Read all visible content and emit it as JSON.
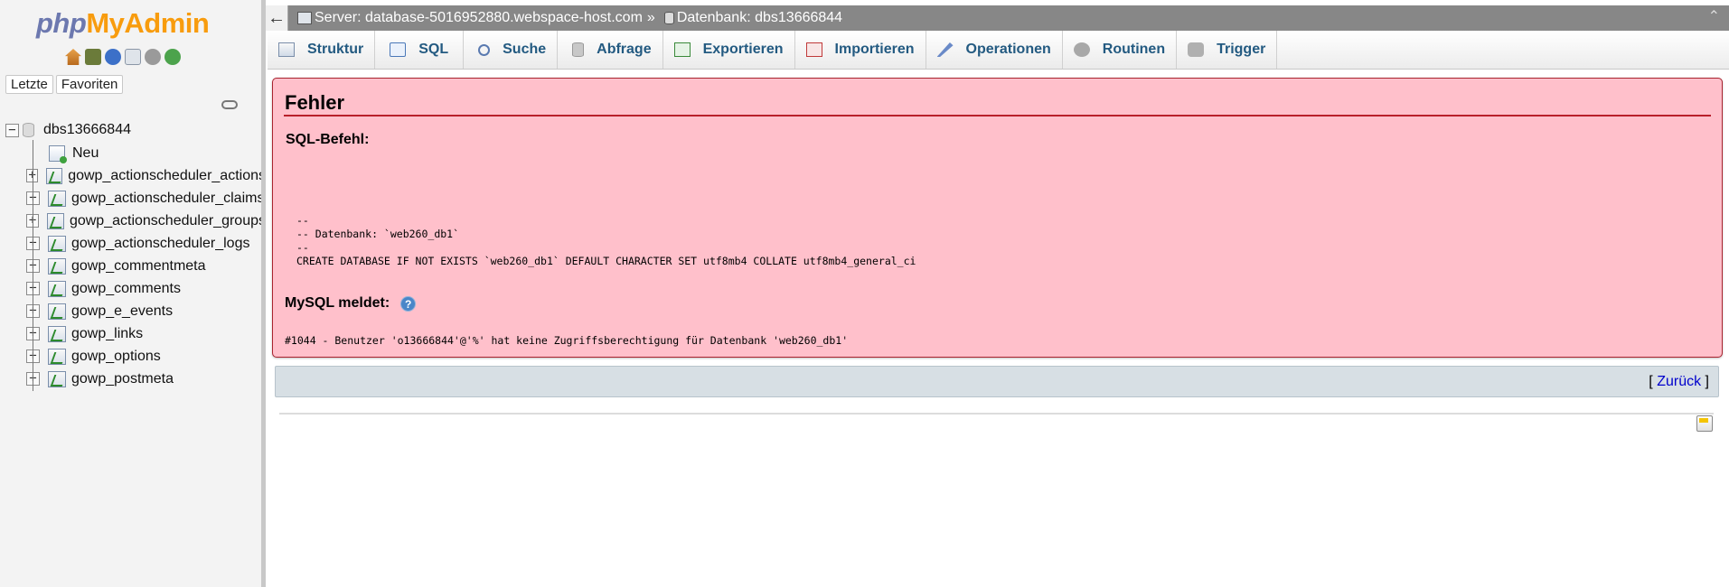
{
  "nav": {
    "logo": {
      "php": "php",
      "my": "My",
      "admin": "Admin"
    },
    "icons": [
      "home-icon",
      "exit-icon",
      "help-icon",
      "docs-icon",
      "settings-icon",
      "reload-icon"
    ],
    "tabs": {
      "recent": "Letzte",
      "favorites": "Favoriten"
    },
    "database": "dbs13666844",
    "new_label": "Neu",
    "expand_symbol": "+",
    "collapse_symbol": "−",
    "tables": [
      "gowp_actionscheduler_actions",
      "gowp_actionscheduler_claims",
      "gowp_actionscheduler_groups",
      "gowp_actionscheduler_logs",
      "gowp_commentmeta",
      "gowp_comments",
      "gowp_e_events",
      "gowp_links",
      "gowp_options",
      "gowp_postmeta"
    ]
  },
  "topbar": {
    "back_symbol": "←",
    "server": "Server: database-5016952880.webspace-host.com",
    "separator": "»",
    "database": "Datenbank: dbs13666844",
    "collapse_symbol": "⌃"
  },
  "tabs": [
    {
      "label": "Struktur",
      "icon": "structure-icon"
    },
    {
      "label": "SQL",
      "icon": "sql-icon"
    },
    {
      "label": "Suche",
      "icon": "search-icon"
    },
    {
      "label": "Abfrage",
      "icon": "query-icon"
    },
    {
      "label": "Exportieren",
      "icon": "export-icon"
    },
    {
      "label": "Importieren",
      "icon": "import-icon"
    },
    {
      "label": "Operationen",
      "icon": "wrench-icon"
    },
    {
      "label": "Routinen",
      "icon": "routines-icon"
    },
    {
      "label": "Trigger",
      "icon": "trigger-icon"
    }
  ],
  "error": {
    "title": "Fehler",
    "sql_label": "SQL-Befehl:",
    "sql_code": "--\n-- Datenbank: `web260_db1`\n--\nCREATE DATABASE IF NOT EXISTS `web260_db1` DEFAULT CHARACTER SET utf8mb4 COLLATE utf8mb4_general_ci",
    "mysql_label": "MySQL meldet:",
    "help_symbol": "?",
    "mysql_message": "#1044 - Benutzer 'o13666844'@'%' hat keine Zugriffsberechtigung für Datenbank 'web260_db1'"
  },
  "back": {
    "open": "[",
    "link": "Zurück",
    "close": "]"
  },
  "colors": {
    "error_bg": "#ffc0cb",
    "error_border": "#a8232f",
    "tab_text": "#235a81",
    "topbar_bg": "#878787"
  }
}
